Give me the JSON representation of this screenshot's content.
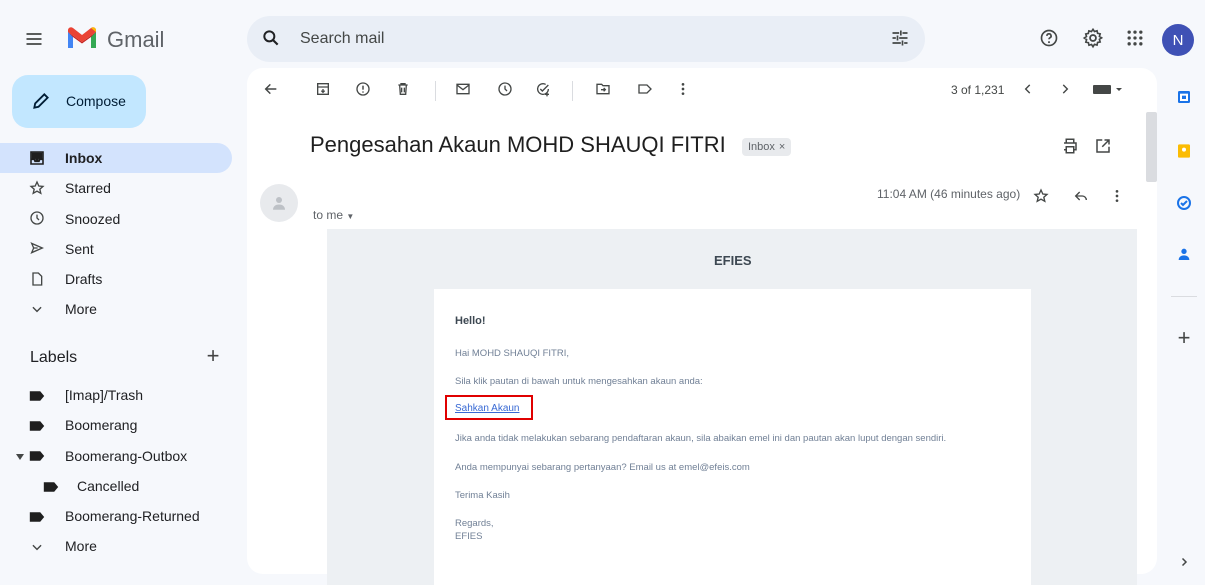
{
  "header": {
    "app_name": "Gmail",
    "search_placeholder": "Search mail",
    "avatar_initial": "N"
  },
  "sidebar": {
    "compose_label": "Compose",
    "items": [
      {
        "label": "Inbox",
        "icon": "inbox-icon"
      },
      {
        "label": "Starred",
        "icon": "star-icon"
      },
      {
        "label": "Snoozed",
        "icon": "clock-icon"
      },
      {
        "label": "Sent",
        "icon": "send-icon"
      },
      {
        "label": "Drafts",
        "icon": "draft-icon"
      },
      {
        "label": "More",
        "icon": "chevron-down-icon"
      }
    ],
    "labels_title": "Labels",
    "labels": [
      {
        "label": "[Imap]/Trash"
      },
      {
        "label": "Boomerang"
      },
      {
        "label": "Boomerang-Outbox"
      },
      {
        "label": "Cancelled"
      },
      {
        "label": "Boomerang-Returned"
      },
      {
        "label": "More"
      }
    ]
  },
  "toolbar": {
    "count": "3 of 1,231"
  },
  "message": {
    "subject": "Pengesahan Akaun MOHD SHAUQI FITRI",
    "label_chip": "Inbox",
    "recipient": "to me",
    "timestamp": "11:04 AM (46 minutes ago)"
  },
  "email_body": {
    "brand": "EFIES",
    "greeting": "Hello!",
    "line1": "Hai MOHD SHAUQI FITRI,",
    "line2": "Sila klik pautan di bawah untuk mengesahkan akaun anda:",
    "link_text": "Sahkan Akaun",
    "line3": "Jika anda tidak melakukan sebarang pendaftaran akaun, sila abaikan emel ini dan pautan akan luput dengan sendiri.",
    "line4": "Anda mempunyai sebarang pertanyaan? Email us at emel@efeis.com",
    "line5": "Terima Kasih",
    "regards": "Regards,",
    "signature": "EFIES"
  },
  "colors": {
    "accent": "#0b57d0",
    "compose_bg": "#c2e7ff",
    "active_nav": "#d3e3fd",
    "highlight_box": "#e00000"
  }
}
